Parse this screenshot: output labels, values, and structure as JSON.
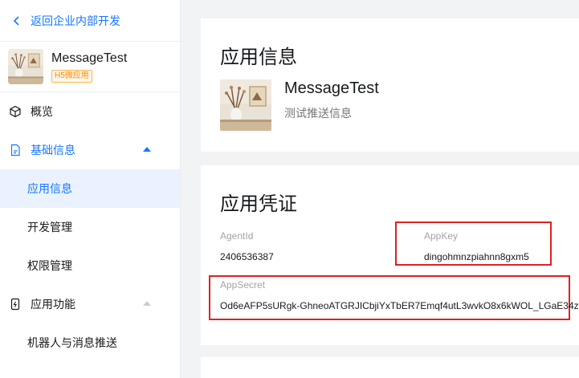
{
  "nav": {
    "back_label": "返回企业内部开发",
    "app_name": "MessageTest",
    "app_tag": "H5微应用",
    "menu": {
      "overview": "概览",
      "basic_info": "基础信息",
      "app_info": "应用信息",
      "dev_manage": "开发管理",
      "perm_manage": "权限管理",
      "app_features": "应用功能",
      "robot_push": "机器人与消息推送"
    }
  },
  "app_info_card": {
    "title": "应用信息",
    "app_name": "MessageTest",
    "description": "测试推送信息"
  },
  "credentials_card": {
    "title": "应用凭证",
    "agent_id_label": "AgentId",
    "agent_id_value": "2406536387",
    "app_key_label": "AppKey",
    "app_key_value": "dingohmnzpiahnn8gxm5",
    "app_secret_label": "AppSecret",
    "app_secret_value": "Od6eAFP5sURgk-GhneoATGRJICbjiYxTbER7Emqf4utL3wvkO8x6kWOL_LGaE34z"
  },
  "colors": {
    "accent": "#1677ff",
    "highlight_box": "#e02020",
    "tag": "#ff8800",
    "page_bg": "#f2f3f5"
  }
}
